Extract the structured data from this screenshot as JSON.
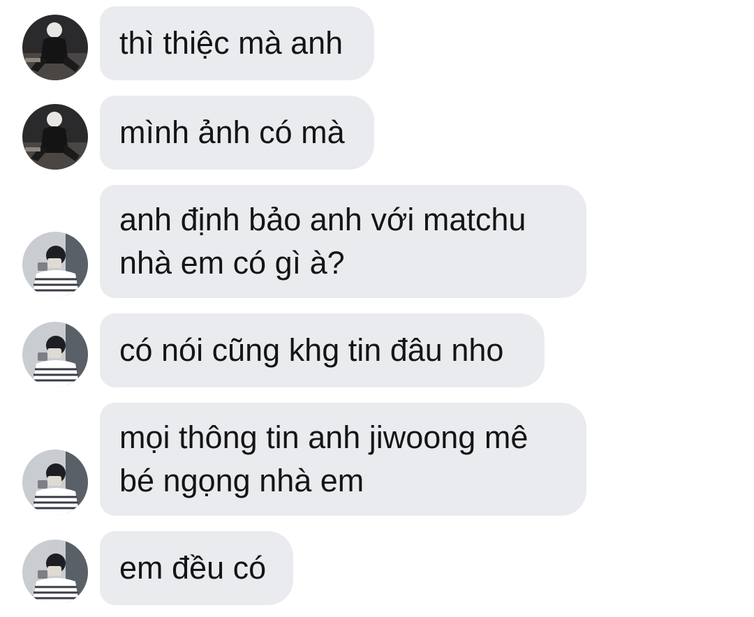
{
  "messages": [
    {
      "text": "thì thiệc mà anh",
      "lines": [
        "thì thiệc mà anh"
      ],
      "sender": "user-a"
    },
    {
      "text": "mình ảnh có mà",
      "lines": [
        "mình ảnh có mà"
      ],
      "sender": "user-a"
    },
    {
      "text": "anh định bảo anh với matchu nhà em có gì à?",
      "lines": [
        "anh định bảo anh với matchu",
        "nhà em có gì à?"
      ],
      "sender": "user-b"
    },
    {
      "text": "có nói cũng khg tin đâu nho",
      "lines": [
        "có nói cũng khg tin đâu nho"
      ],
      "sender": "user-b"
    },
    {
      "text": "mọi thông tin anh jiwoong mê bé ngọng nhà em",
      "lines": [
        "mọi thông tin anh jiwoong mê",
        "bé ngọng nhà em"
      ],
      "sender": "user-b"
    },
    {
      "text": "em đều có",
      "lines": [
        "em đều có"
      ],
      "sender": "user-b"
    }
  ],
  "colors": {
    "bubble": "#e9ebef",
    "text": "#151515",
    "background": "#ffffff"
  }
}
